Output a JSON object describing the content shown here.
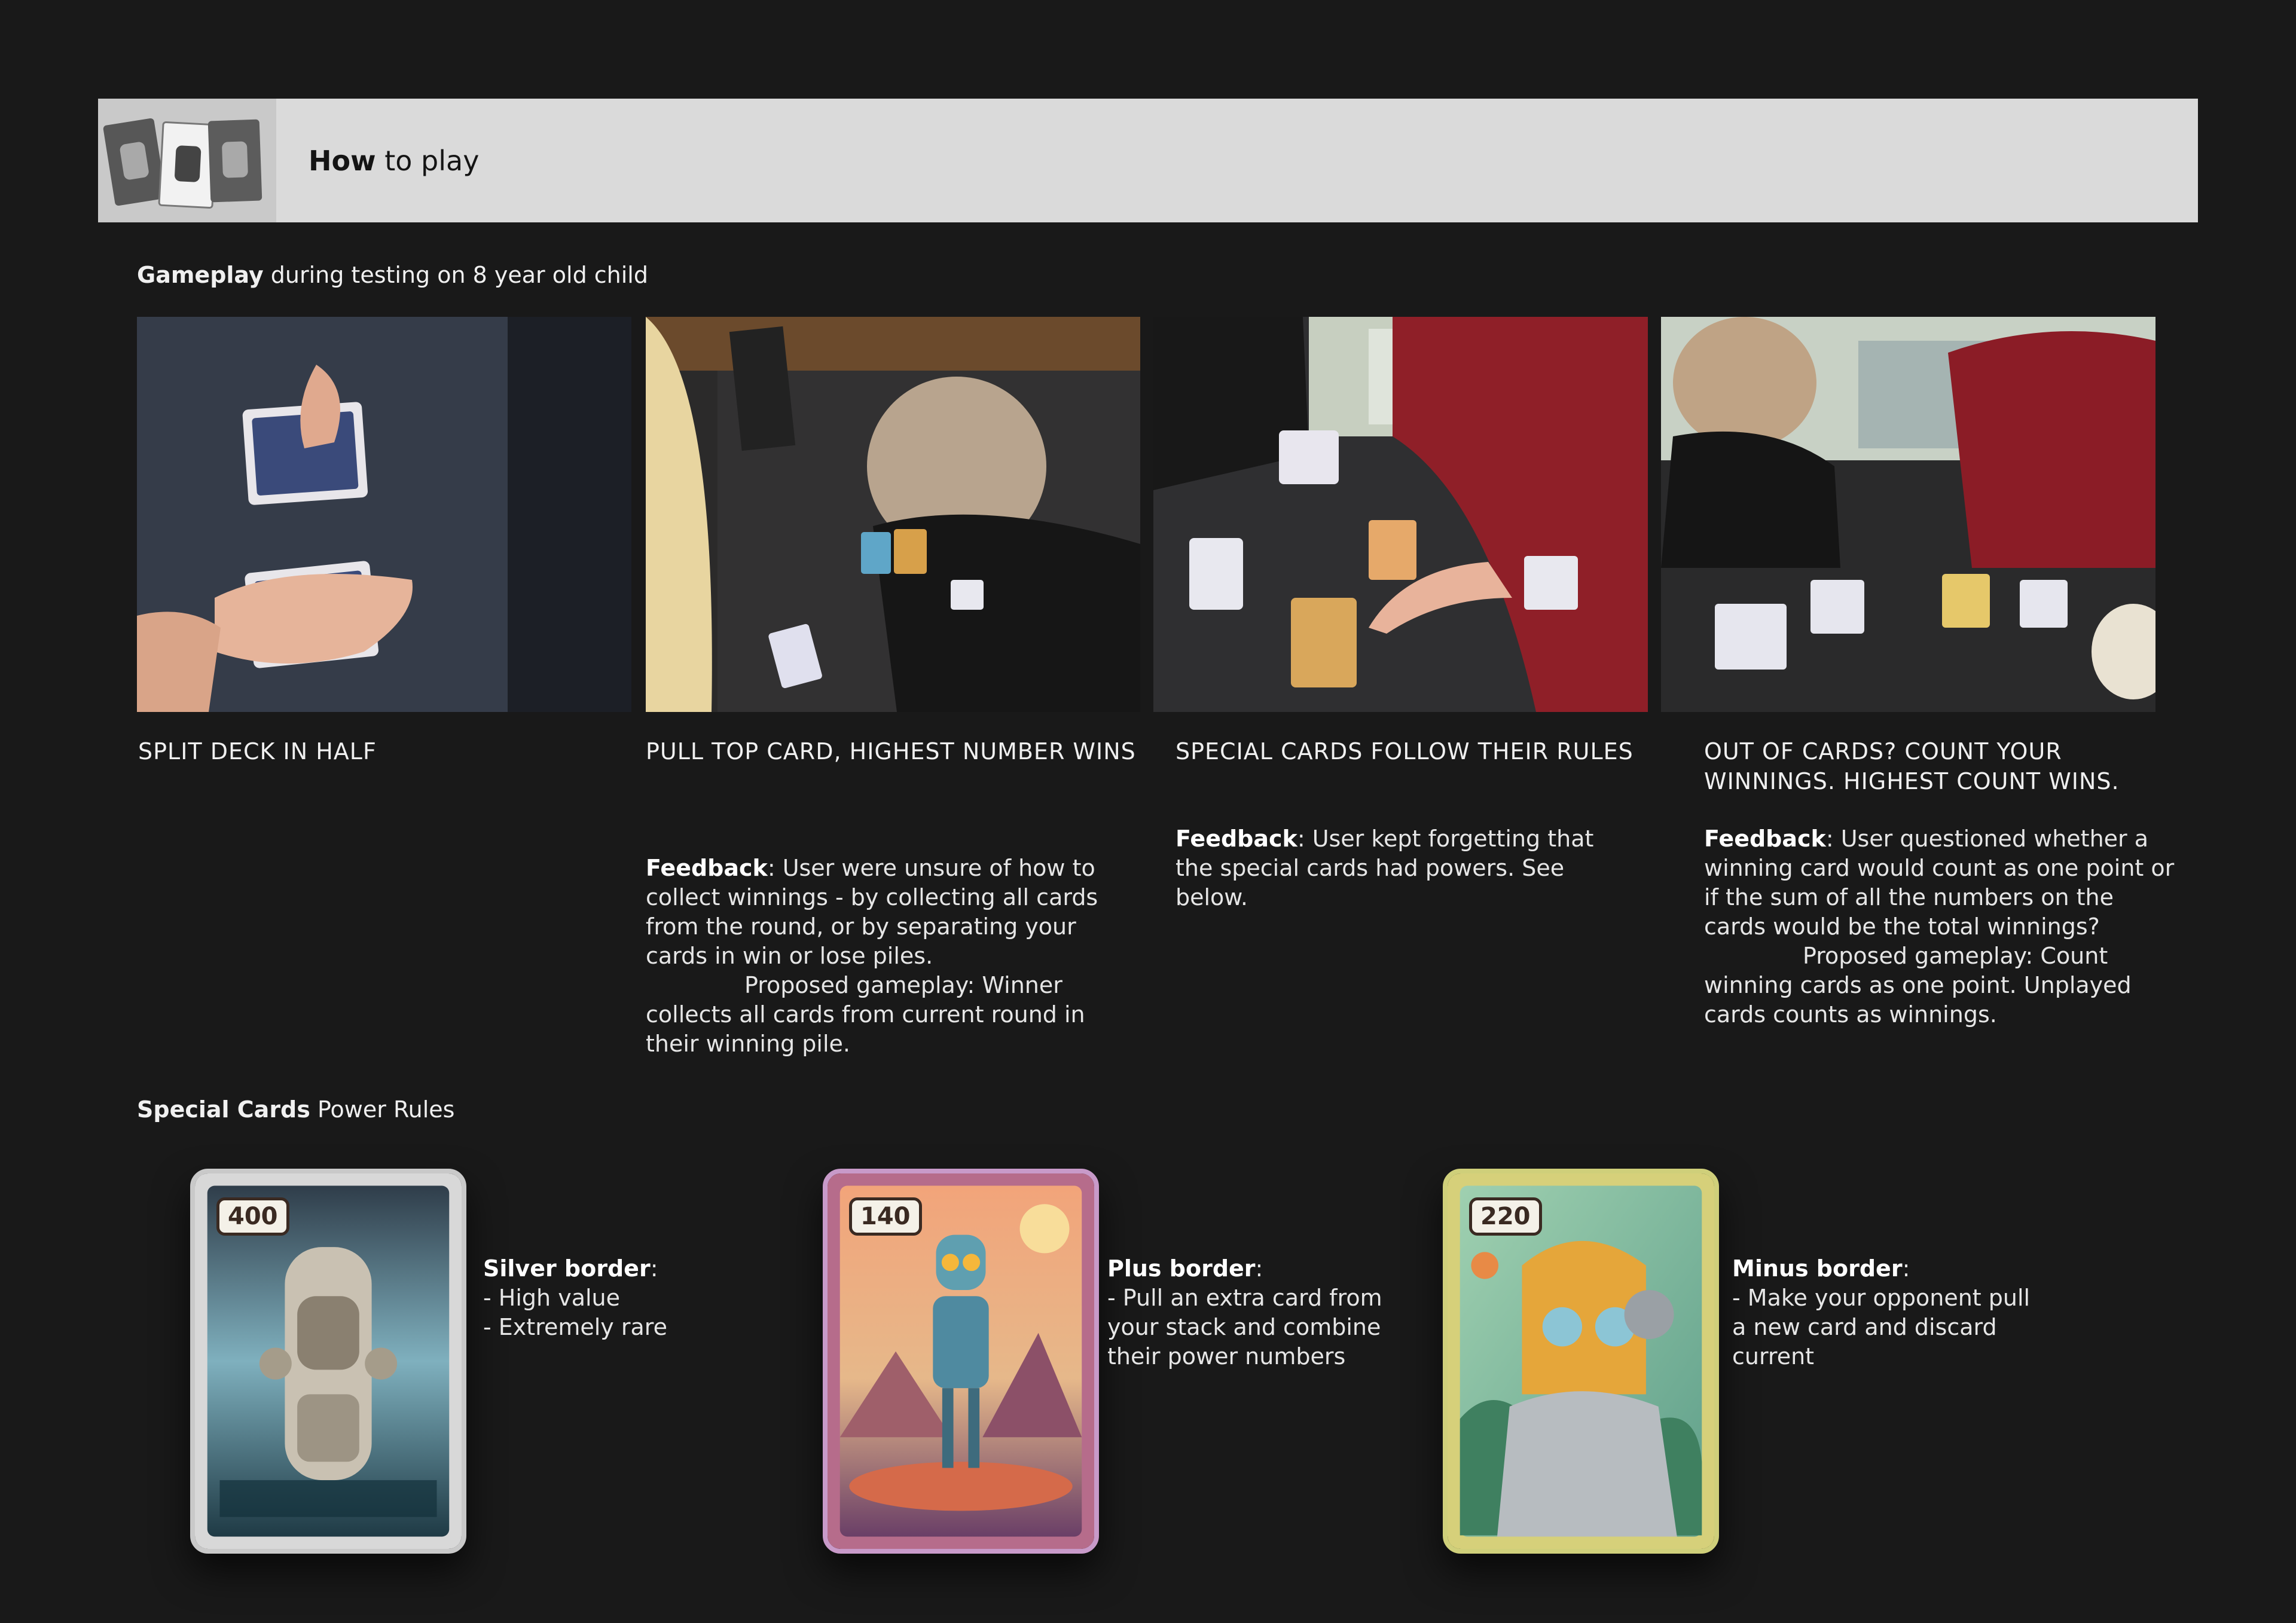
{
  "header": {
    "title_bold": "How",
    "title_rest": " to play"
  },
  "gameplay_heading": {
    "bold": "Gameplay",
    "rest": " during testing on 8 year old child"
  },
  "steps": [
    {
      "title": "SPLIT DECK IN HALF",
      "feedback_label": "",
      "feedback_text": "",
      "proposed": ""
    },
    {
      "title": "PULL TOP CARD, HIGHEST NUMBER WINS",
      "feedback_label": "Feedback",
      "feedback_text": ": User were unsure of how to collect winnings - by collecting all cards from the round, or by separating your cards in win or lose piles.",
      "proposed": "Proposed gameplay: Winner collects all cards from current round in their winning pile."
    },
    {
      "title": "SPECIAL CARDS FOLLOW THEIR RULES",
      "feedback_label": "Feedback",
      "feedback_text": ": User kept forgetting that the special cards had powers. See below.",
      "proposed": ""
    },
    {
      "title": "OUT OF CARDS? COUNT YOUR WINNINGS. HIGHEST COUNT WINS.",
      "feedback_label": "Feedback",
      "feedback_text": ": User questioned whether a winning card would count as one point or if the sum of all the numbers on the cards would be the total winnings?",
      "proposed": "Proposed gameplay: Count winning cards as one point. Unplayed cards counts as winnings."
    }
  ],
  "special_heading": {
    "bold": "Special Cards",
    "rest": " Power Rules"
  },
  "special_cards": [
    {
      "value": "400",
      "rule_label": "Silver border",
      "rule_colon": ":",
      "lines": [
        "- High value",
        "- Extremely rare"
      ]
    },
    {
      "value": "140",
      "rule_label": "Plus border",
      "rule_colon": ":",
      "lines": [
        "- Pull an extra card from",
        "your stack and combine",
        "their power numbers"
      ]
    },
    {
      "value": "220",
      "rule_label": "Minus border",
      "rule_colon": ":",
      "lines": [
        "- Make your opponent pull",
        "a new card and discard",
        "current"
      ]
    }
  ],
  "colors": {
    "background": "#191919",
    "banner": "#dadada",
    "text": "#ececec"
  }
}
